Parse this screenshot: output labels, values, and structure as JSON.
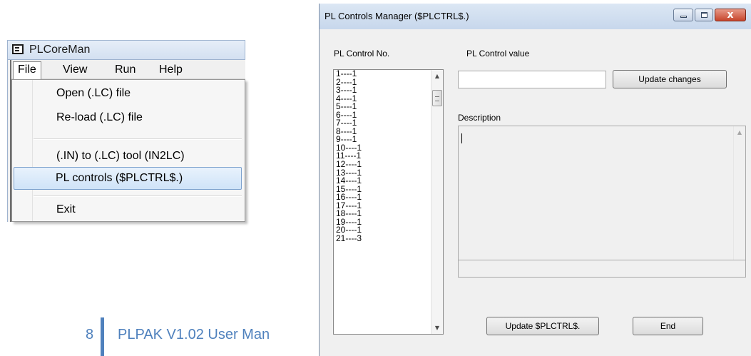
{
  "menu_window": {
    "title": "PLCoreMan",
    "menubar": [
      "File",
      "View",
      "Run",
      "Help"
    ],
    "file_menu_items": [
      "Open (.LC) file",
      "Re-load (.LC) file",
      "(.IN) to (.LC) tool (IN2LC)",
      "PL controls ($PLCTRL$.)",
      "Exit"
    ],
    "highlighted_item": "PL controls ($PLCTRL$.)"
  },
  "footer": {
    "page_number": "8",
    "text": "PLPAK  V1.02 User Man"
  },
  "pl_window": {
    "title": "PL Controls Manager ($PLCTRL$.)",
    "control_no_label": "PL Control No.",
    "control_value_label": "PL Control value",
    "value_input": "",
    "update_changes_label": "Update changes",
    "description_label": "Description",
    "description_text": "",
    "update_plctrl_label": "Update $PLCTRL$.",
    "end_label": "End",
    "close_glyph": "x",
    "list_items": [
      "1----1",
      "2----1",
      "3----1",
      "4----1",
      "5----1",
      "6----1",
      "7----1",
      "8----1",
      "9----1",
      "10----1",
      "11----1",
      "12----1",
      "13----1",
      "14----1",
      "15----1",
      "16----1",
      "17----1",
      "18----1",
      "19----1",
      "20----1",
      "21----3"
    ]
  },
  "colors": {
    "footer_accent": "#4f81bd",
    "menu_highlight": "#cfe3f8",
    "title_bar": "#c7d7ec",
    "close_button": "#c7452c"
  },
  "icons": [
    "app-window-icon",
    "minimize-icon",
    "maximize-icon",
    "close-icon",
    "scroll-up-arrow-icon",
    "scroll-down-arrow-icon"
  ]
}
